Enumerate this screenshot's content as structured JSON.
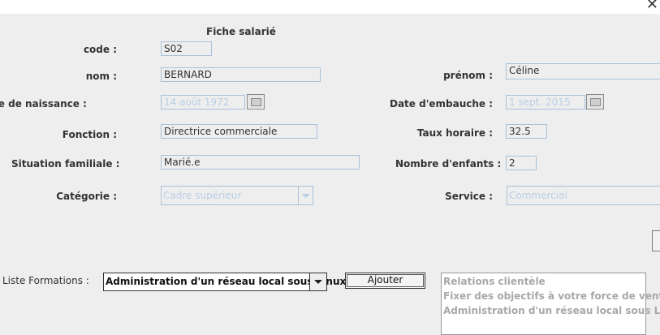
{
  "window": {
    "close_symbol": "✕"
  },
  "form": {
    "title": "Fiche salarié",
    "code": {
      "label": "code :",
      "value": "S02"
    },
    "nom": {
      "label": "nom :",
      "value": "BERNARD"
    },
    "prenom": {
      "label": "prénom :",
      "value": "Céline"
    },
    "date_naissance": {
      "label": "Date de naissance :",
      "value": "14 août 1972"
    },
    "date_embauche": {
      "label": "Date d'embauche :",
      "value": "1 sept. 2015"
    },
    "fonction": {
      "label": "Fonction :",
      "value": "Directrice commerciale"
    },
    "taux_horaire": {
      "label": "Taux horaire :",
      "value": "32.5"
    },
    "situation": {
      "label": "Situation familiale :",
      "value": "Marié.e"
    },
    "enfants": {
      "label": "Nombre d'enfants :",
      "value": "2"
    },
    "categorie": {
      "label": "Catégorie :",
      "value": "Cadre supérieur"
    },
    "service": {
      "label": "Service :",
      "value": "Commercial"
    }
  },
  "formations": {
    "label": "Liste Formations :",
    "selected": "Administration d'un réseau local sous Linux",
    "add_button": "Ajouter",
    "list": [
      "Relations clientèle",
      "Fixer des objectifs à votre force de vente",
      "Administration d'un réseau local sous Linux"
    ]
  }
}
